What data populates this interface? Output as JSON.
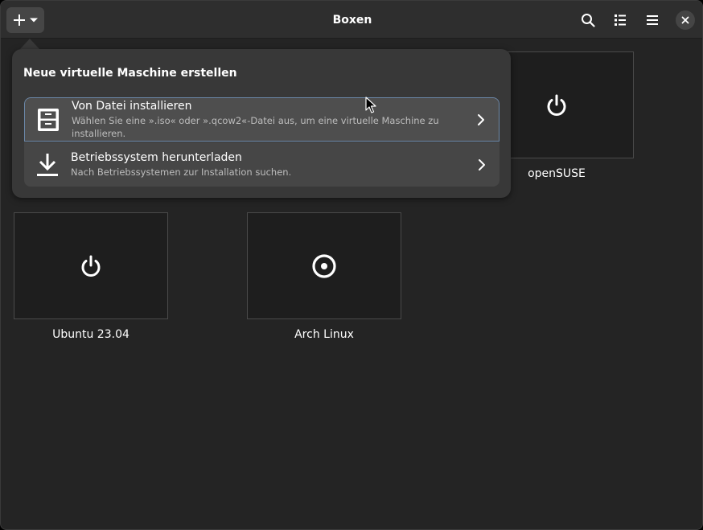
{
  "header": {
    "title": "Boxen"
  },
  "popover": {
    "title": "Neue virtuelle Maschine erstellen",
    "items": [
      {
        "title": "Von Datei installieren",
        "subtitle": "Wählen Sie eine ».iso« oder ».qcow2«-Datei aus, um eine virtuelle Maschine zu installieren.",
        "icon": "file-cabinet-icon"
      },
      {
        "title": "Betriebssystem herunterladen",
        "subtitle": "Nach Betriebssystemen zur Installation suchen.",
        "icon": "download-icon"
      }
    ]
  },
  "machines": [
    {
      "name": "openSUSE",
      "icon": "power-icon"
    },
    {
      "name": "Ubuntu 23.04",
      "icon": "power-icon"
    },
    {
      "name": "Arch Linux",
      "icon": "disc-icon"
    }
  ],
  "colors": {
    "window_bg": "#242424",
    "headerbar_bg": "#2e2e2e",
    "popover_bg": "#383838",
    "list_bg": "#464646",
    "focus_border": "#6b87a8"
  }
}
